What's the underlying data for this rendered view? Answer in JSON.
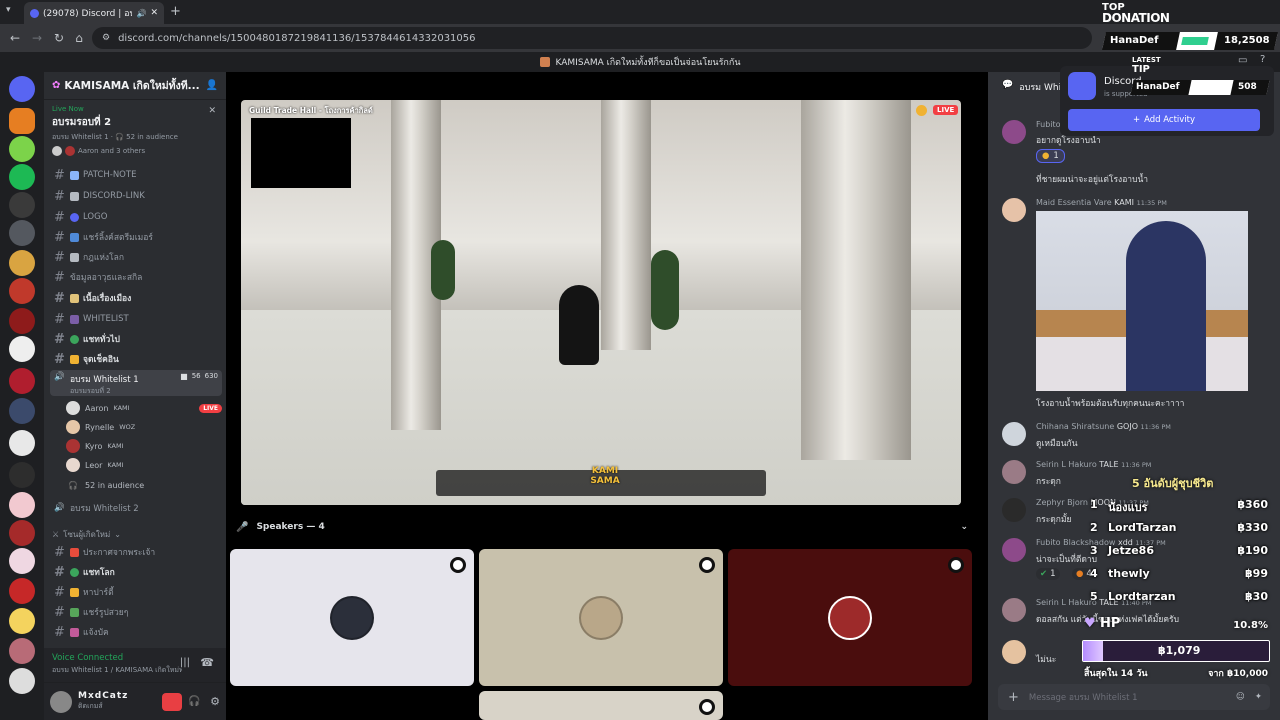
{
  "browser": {
    "tab_title": "(29078) Discord | อบรม Whitelist",
    "url": "discord.com/channels/1500480187219841136/1537844614332031056",
    "page_title": "KAMISAMA เกิดใหม่ทั้งทีก็ขอเป็นจ่อนโยนรักกัน"
  },
  "server": {
    "name": "KAMISAMA เกิดใหม่ทั้งที...",
    "live_label": "Live Now",
    "live_title": "อบรมรอบที่ 2",
    "live_sub": "อบรม Whitelist 1 · 🎧 52 in audience",
    "live_people": "Aaron and 3 others",
    "channels": [
      {
        "name": "PATCH-NOTE",
        "bright": false
      },
      {
        "name": "DISCORD-LINK",
        "bright": false
      },
      {
        "name": "LOGO",
        "bright": false
      },
      {
        "name": "แชร์ลิ้งค์สตรีมเมอร์",
        "bright": false
      },
      {
        "name": "กฎแห่งโลก",
        "bright": false
      },
      {
        "name": "ข้อมูลอาวุธและสกิล",
        "bright": false
      },
      {
        "name": "เนื้อเรื่องเมือง",
        "bright": true
      },
      {
        "name": "WHITELIST",
        "bright": false
      },
      {
        "name": "แชททั่วไป",
        "bright": true
      },
      {
        "name": "จุดเช็คอิน",
        "bright": true
      }
    ],
    "voice_channel": {
      "name": "อบรม Whitelist 1",
      "sub": "อบรมรอบที่ 2",
      "count_a": "56",
      "count_b": "630"
    },
    "voice_users": [
      {
        "name": "Aaron",
        "tag": "KAMI",
        "live": "LIVE"
      },
      {
        "name": "Rynelle",
        "tag": "WOZ",
        "live": ""
      },
      {
        "name": "Kyro",
        "tag": "KAMI",
        "live": ""
      },
      {
        "name": "Leor",
        "tag": "KAMI",
        "live": ""
      }
    ],
    "audience": "52 in audience",
    "voice_channel_2": "อบรม Whitelist 2",
    "category": "โซนผู้เกิดใหม่",
    "channels_2": [
      {
        "name": "ประกาศจากพระเจ้า",
        "bright": false
      },
      {
        "name": "แชทโลก",
        "bright": true
      },
      {
        "name": "หาปาร์ตี้",
        "bright": false
      },
      {
        "name": "แชร์รูปสวยๆ",
        "bright": false
      },
      {
        "name": "แจ้งบัค",
        "bright": false
      }
    ]
  },
  "voice_panel": {
    "status": "Voice Connected",
    "channel": "อบรม Whitelist 1 / KAMISAMA เกิดใหม่ท..."
  },
  "user_panel": {
    "name": "MxdCatz",
    "status": "ติดเกมส์"
  },
  "stream": {
    "overlay_title": "Guild Trade Hall - โถงการค้ากิลด์",
    "live_badge": "LIVE",
    "logo": "KAMI SAMA"
  },
  "speakers": {
    "label": "Speakers — 4"
  },
  "chat": {
    "header": "อบรม Whi",
    "messages": [
      {
        "name": "Fubito",
        "text": "อยากดูโรงอาบน้ำ",
        "reaction": "1"
      },
      {
        "name": "",
        "text": "ที่ชายผมน่าจะอยู่แต่โรงอาบน้ำ"
      },
      {
        "name": "Maid Essentia Vare",
        "tag": "KAMI",
        "time": "11:35 PM"
      },
      {
        "name": "",
        "text": "โรงอาบน้ำพร้อมต้อนรับทุกคนนะคะาาาา"
      },
      {
        "name": "Chihana Shiratsune",
        "tag": "GOJO",
        "time": "11:36 PM",
        "text": "ดูเหมือนกัน"
      },
      {
        "name": "Seirin L Hakuro",
        "tag": "TALE",
        "time": "11:36 PM",
        "text": "กระดุก"
      },
      {
        "name": "Zephyr Bjorn",
        "tag": "MOON",
        "time": "11:37 PM",
        "text": "กระดุกมั้ย"
      },
      {
        "name": "Fubito Blackshadow",
        "tag": "xdd",
        "time": "11:37 PM",
        "text": "น่าจะเป็นที่ตีดาบ",
        "reaction_a": "1",
        "reaction_b": "4"
      },
      {
        "name": "Seirin L Hakuro",
        "tag": "TALE",
        "time": "11:40 PM",
        "text": "ดอลสกัน แต่วันนี้ของแห่งเฟคได้มั้ยครับ"
      },
      {
        "name": "",
        "text": "ไม่นะ"
      }
    ],
    "input_placeholder": "Message อบรม Whitelist 1"
  },
  "activity": {
    "title": "Discord",
    "sub": "is supported",
    "button": "Add Activity"
  },
  "donation": {
    "top_label": "TOP",
    "top_title": "DONATION",
    "top_name": "HanaDef",
    "top_amount": "18,2508",
    "latest_label": "LATEST",
    "latest_title": "TIP",
    "latest_name": "HanaDef",
    "latest_amount": "508"
  },
  "leaderboard": {
    "title": "5 อันดับผู้ชุบชีวิต",
    "rows": [
      {
        "rank": "1",
        "name": "น้องแบร",
        "amount": "฿360"
      },
      {
        "rank": "2",
        "name": "LordTarzan",
        "amount": "฿330"
      },
      {
        "rank": "3",
        "name": "Jetze86",
        "amount": "฿190"
      },
      {
        "rank": "4",
        "name": "thewly",
        "amount": "฿99"
      },
      {
        "rank": "5",
        "name": "Lordtarzan",
        "amount": "฿30"
      }
    ],
    "hp_label": "HP",
    "hp_percent": "10.8%",
    "hp_fill": 0.108,
    "current": "฿1,079",
    "ends": "สิ้นสุดใน 14 วัน",
    "goal": "จาก ฿10,000"
  }
}
